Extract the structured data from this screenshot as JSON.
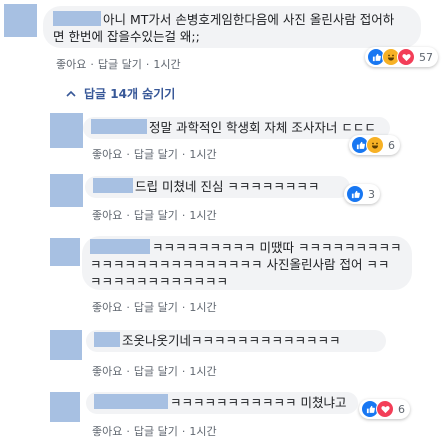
{
  "main_comment": {
    "text": "아니 MT가서 손병호게임한다음에 사진 올린사람 접어하면 한번에 잡을수있는걸 왜;;",
    "line1": "아니 MT가서 손병호게임한다음에 사진 올린사람 접어하",
    "line2": "면 한번에 잡을수있는걸 왜;;",
    "like_label": "좋아요",
    "reply_label": "답글 달기",
    "time": "1시간",
    "reaction_count": "57"
  },
  "replies_toggle": {
    "label": "답글 14개 숨기기"
  },
  "replies": [
    {
      "text": "정말 과학적인 학생회 자체 조사자너 ㄷㄷㄷ",
      "like_label": "좋아요",
      "reply_label": "답글 달기",
      "time": "1시간",
      "reaction_count": "6"
    },
    {
      "text": "드립 미쳤네 진심 ㅋㅋㅋㅋㅋㅋㅋㅋ",
      "like_label": "좋아요",
      "reply_label": "답글 달기",
      "time": "1시간",
      "reaction_count": "3"
    },
    {
      "line1": "ㅋㅋㅋㅋㅋㅋㅋㅋㅋ 미땠따 ㅋㅋㅋㅋㅋㅋㅋㅋㅋ",
      "line2": "ㅋㅋㅋㅋㅋㅋㅋㅋㅋㅋㅋㅋㅋㅋㅋ 사진올린사람 접어 ㅋㅋ",
      "line3": "ㅋㅋㅋㅋㅋㅋㅋㅋㅋㅋㅋㅋ",
      "like_label": "좋아요",
      "reply_label": "답글 달기",
      "time": "1시간"
    },
    {
      "text": "조옷나옷기네ㅋㅋㅋㅋㅋㅋㅋㅋㅋㅋㅋㅋㅋ",
      "like_label": "좋아요",
      "reply_label": "답글 달기",
      "time": "1시간"
    },
    {
      "text": "ㅋㅋㅋㅋㅋㅋㅋㅋㅋㅋㅋ 미쳤냐고",
      "like_label": "좋아요",
      "reply_label": "답글 달기",
      "time": "1시간",
      "reaction_count": "6"
    }
  ],
  "colors": {
    "avatar_placeholder": "#a7c0e2",
    "link": "#385898",
    "like": "#1877f2",
    "love": "#f33e58",
    "haha": "#f7b125"
  },
  "icons": [
    "like-icon",
    "love-icon",
    "haha-icon",
    "reply-arrow-icon"
  ]
}
